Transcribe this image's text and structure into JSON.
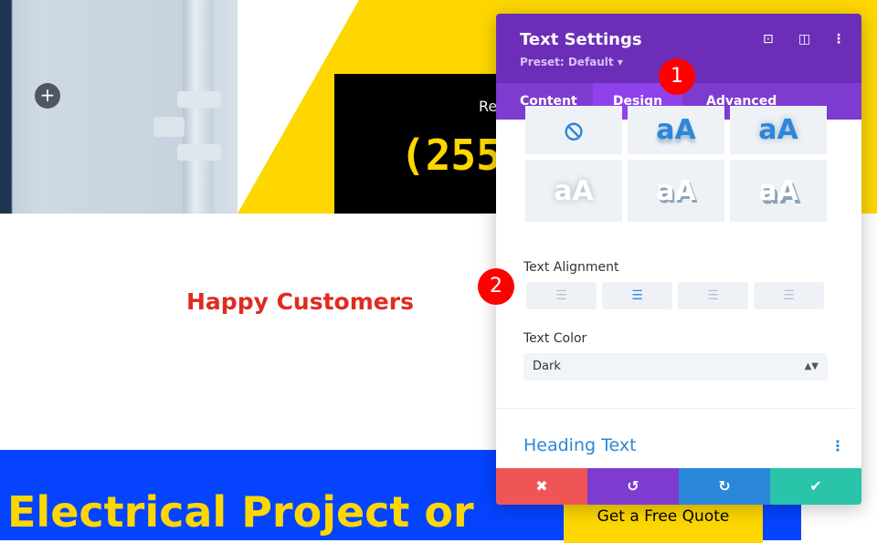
{
  "page": {
    "add_label": "+",
    "contact_label": "Re",
    "phone": "(255",
    "happy": "Happy Customers",
    "project": "Electrical Project or",
    "quote_button": "Get a Free Quote"
  },
  "panel": {
    "title": "Text Settings",
    "preset": "Preset: Default ▾",
    "icons": [
      "fullscreen-icon",
      "split-view-icon",
      "more-icon"
    ],
    "tabs": [
      {
        "label": "Content"
      },
      {
        "label": "Design",
        "active": true
      },
      {
        "label": "Advanced"
      }
    ],
    "shadow_sample": "aA",
    "none_icon": "⦸",
    "text_alignment_label": "Text Alignment",
    "alignment_options": [
      "left",
      "center",
      "right",
      "justify"
    ],
    "alignment_selected": "center",
    "text_color_label": "Text Color",
    "text_color_value": "Dark",
    "heading_text": "Heading Text",
    "footer": {
      "cancel": "✖",
      "undo": "↺",
      "redo": "↻",
      "save": "✔"
    }
  },
  "badges": [
    "1",
    "2"
  ],
  "colors": {
    "purple": "#6c2eb9",
    "accent": "#2b87da",
    "yellow": "#fed700",
    "blue": "#0543ff",
    "red": "#e02b20"
  }
}
